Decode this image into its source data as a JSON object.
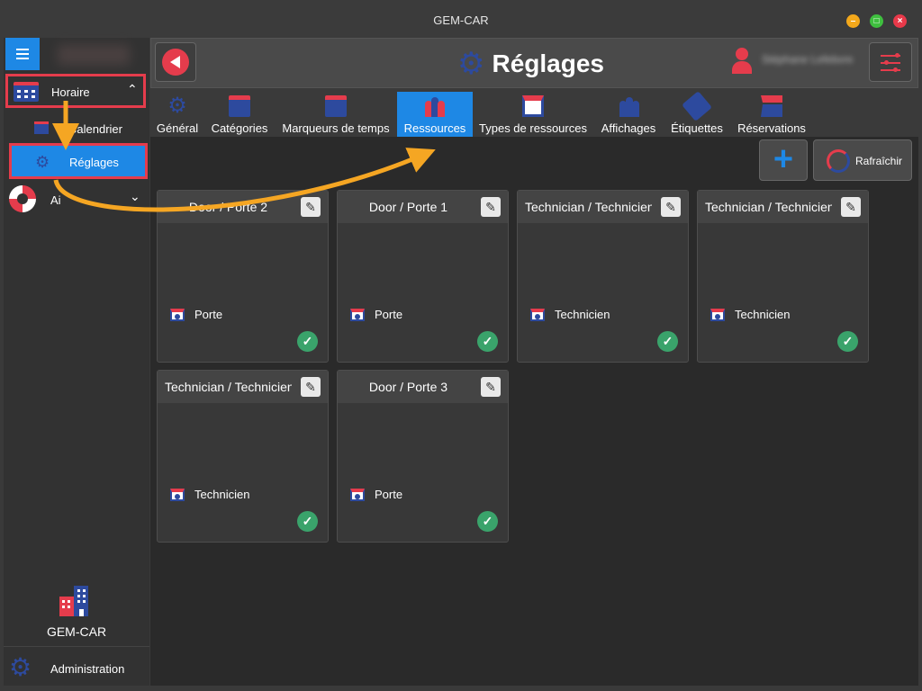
{
  "window": {
    "title": "GEM-CAR"
  },
  "sidebar": {
    "horaire": {
      "label": "Horaire"
    },
    "calendrier": {
      "label": "Calendrier"
    },
    "reglages": {
      "label": "Réglages"
    },
    "aide": {
      "label": "Ai"
    },
    "brand": {
      "label": "GEM-CAR"
    },
    "admin": {
      "label": "Administration"
    }
  },
  "header": {
    "title": "Réglages",
    "user_name": "Stéphane Lefebvre"
  },
  "tabs": [
    {
      "label": "Général",
      "icon": "gear-icon"
    },
    {
      "label": "Catégories",
      "icon": "calendar-grid-icon"
    },
    {
      "label": "Marqueurs de temps",
      "icon": "calendar-clock-icon"
    },
    {
      "label": "Ressources",
      "icon": "people-group-icon",
      "active": true
    },
    {
      "label": "Types de ressources",
      "icon": "id-card-icon"
    },
    {
      "label": "Affichages",
      "icon": "crowd-icon"
    },
    {
      "label": "Étiquettes",
      "icon": "tag-icon"
    },
    {
      "label": "Réservations",
      "icon": "building-icon"
    }
  ],
  "actions": {
    "refresh_label": "Rafraîchir",
    "add_icon": "plus-icon"
  },
  "resources": [
    {
      "title": "Door / Porte 2",
      "type": "Porte"
    },
    {
      "title": "Door / Porte 1",
      "type": "Porte"
    },
    {
      "title": "Technician / Technicien",
      "type": "Technicien"
    },
    {
      "title": "Technician / Technicien",
      "type": "Technicien"
    },
    {
      "title": "Technician / Technicien",
      "type": "Technicien"
    },
    {
      "title": "Door / Porte 3",
      "type": "Porte"
    }
  ],
  "colors": {
    "accent_blue": "#1e88e5",
    "brand_red": "#e53c4c",
    "brand_navy": "#2d4a9e",
    "check_green": "#3aa36b",
    "annotation_orange": "#f5a623"
  }
}
